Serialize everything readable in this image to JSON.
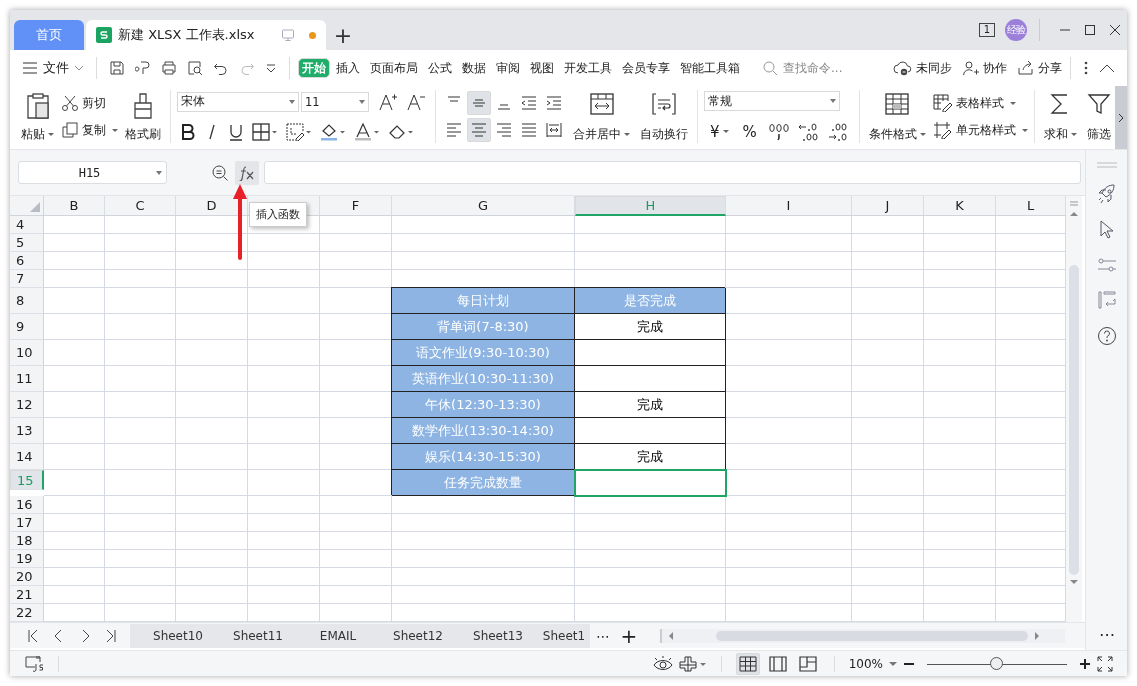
{
  "window": {
    "home_tab": "首页",
    "doc_tab": {
      "title": "新建 XLSX 工作表.xlsx",
      "unsaved": true
    },
    "new_tab": "+",
    "window_count": "1",
    "avatar": "经验"
  },
  "menu": {
    "file": "文件",
    "tabs": [
      {
        "label": "开始",
        "selected": true
      },
      {
        "label": "插入",
        "selected": false
      },
      {
        "label": "页面布局",
        "selected": false
      },
      {
        "label": "公式",
        "selected": false
      },
      {
        "label": "数据",
        "selected": false
      },
      {
        "label": "审阅",
        "selected": false
      },
      {
        "label": "视图",
        "selected": false
      },
      {
        "label": "开发工具",
        "selected": false
      },
      {
        "label": "会员专享",
        "selected": false
      },
      {
        "label": "智能工具箱",
        "selected": false
      }
    ],
    "search": {
      "placeholder": "查找命令..."
    },
    "sync": "未同步",
    "collaborate": "协作",
    "share": "分享"
  },
  "ribbon": {
    "paste": "粘贴",
    "cut": "剪切",
    "copy": "复制",
    "format_painter": "格式刷",
    "font": "宋体",
    "font_size": "11",
    "align_buttons": [
      {
        "selected": false
      },
      {
        "selected": true
      },
      {
        "selected": false
      },
      {
        "selected": false
      },
      {
        "selected": false
      },
      {
        "selected": false
      },
      {
        "selected": true
      },
      {
        "selected": false
      },
      {
        "selected": false
      },
      {
        "selected": false
      }
    ],
    "merge": "合并居中",
    "wrap": "自动换行",
    "number_format": "常规",
    "currency": "¥",
    "percent": "%",
    "conditional_format": "条件格式",
    "table_style": "表格样式",
    "cell_style": "单元格样式",
    "sum": "求和",
    "filter": "筛选"
  },
  "formula_bar": {
    "name_box": "H15",
    "tooltip": "插入函数"
  },
  "sheet": {
    "columns": [
      {
        "label": "B",
        "selected": false
      },
      {
        "label": "C",
        "selected": false
      },
      {
        "label": "D",
        "selected": false
      },
      {
        "selected": false
      },
      {
        "label": "F",
        "selected": false
      },
      {
        "label": "G",
        "selected": false
      },
      {
        "label": "H",
        "selected": true
      },
      {
        "label": "I",
        "selected": false
      },
      {
        "label": "J",
        "selected": false
      },
      {
        "label": "K",
        "selected": false
      },
      {
        "label": "L",
        "selected": false
      }
    ],
    "rows": [
      {
        "number": "4",
        "selected": false
      },
      {
        "number": "5",
        "selected": false
      },
      {
        "number": "6",
        "selected": false
      },
      {
        "number": "7",
        "selected": false
      },
      {
        "number": "8",
        "selected": false,
        "cells": [
          {
            "text": "每日计划",
            "kind": "header",
            "selected": false
          },
          {
            "text": "是否完成",
            "kind": "header",
            "selected": false
          }
        ]
      },
      {
        "number": "9",
        "selected": false,
        "cells": [
          {
            "text": "背单词(7-8:30)",
            "kind": "label",
            "selected": false
          },
          {
            "text": "完成",
            "kind": "value",
            "selected": false
          }
        ]
      },
      {
        "number": "10",
        "selected": false,
        "cells": [
          {
            "text": "语文作业(9:30-10:30)",
            "kind": "label",
            "selected": false
          },
          {
            "kind": "value",
            "selected": false
          }
        ]
      },
      {
        "number": "11",
        "selected": false,
        "cells": [
          {
            "text": "英语作业(10:30-11:30)",
            "kind": "label",
            "selected": false
          },
          {
            "kind": "value",
            "selected": false
          }
        ]
      },
      {
        "number": "12",
        "selected": false,
        "cells": [
          {
            "text": "午休(12:30-13:30)",
            "kind": "label",
            "selected": false
          },
          {
            "text": "完成",
            "kind": "value",
            "selected": false
          }
        ]
      },
      {
        "number": "13",
        "selected": false,
        "cells": [
          {
            "text": "数学作业(13:30-14:30)",
            "kind": "label",
            "selected": false
          },
          {
            "kind": "value",
            "selected": false
          }
        ]
      },
      {
        "number": "14",
        "selected": false,
        "cells": [
          {
            "text": "娱乐(14:30-15:30)",
            "kind": "label",
            "selected": false
          },
          {
            "text": "完成",
            "kind": "value",
            "selected": false
          }
        ]
      },
      {
        "number": "15",
        "selected": true,
        "cells": [
          {
            "text": "任务完成数量",
            "kind": "label",
            "selected": false
          },
          {
            "kind": "value",
            "selected": true
          }
        ]
      },
      {
        "number": "16",
        "selected": false
      },
      {
        "number": "17",
        "selected": false
      },
      {
        "number": "18",
        "selected": false
      },
      {
        "number": "19",
        "selected": false
      },
      {
        "number": "20",
        "selected": false
      },
      {
        "number": "21",
        "selected": false
      },
      {
        "number": "22",
        "selected": false
      }
    ]
  },
  "sheet_tabs": [
    "Sheet10",
    "Sheet11",
    "EMAIL",
    "Sheet12",
    "Sheet13",
    "Sheet1"
  ],
  "sheet_more": "⋯",
  "add_sheet": "+",
  "panel_more": "⋯",
  "status_bar": {
    "views": [
      {
        "selected": true
      },
      {
        "selected": false
      },
      {
        "selected": false
      }
    ],
    "zoom": "100%",
    "zoom_slider": {
      "level": 0.5
    }
  }
}
